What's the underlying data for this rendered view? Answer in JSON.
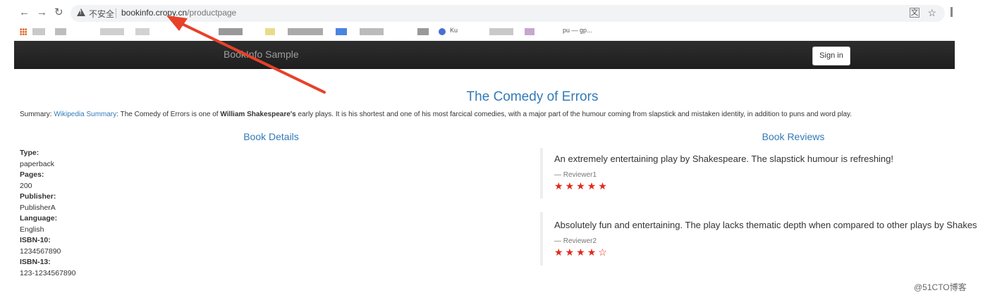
{
  "browser": {
    "insecure_label": "不安全",
    "url_domain": "bookinfo.cropy.cn",
    "url_path": "/productpage",
    "bookmark_texts": [
      "Ku",
      "pu — gp..."
    ]
  },
  "navbar": {
    "brand": "BookInfo Sample",
    "signin_label": "Sign in"
  },
  "product": {
    "title": "The Comedy of Errors",
    "summary_label": "Summary: ",
    "summary_link": "Wikipedia Summary",
    "summary_pre": ": The Comedy of Errors is one of ",
    "summary_author": "William Shakespeare's",
    "summary_post": " early plays. It is his shortest and one of his most farcical comedies, with a major part of the humour coming from slapstick and mistaken identity, in addition to puns and word play."
  },
  "details": {
    "heading": "Book Details",
    "items": [
      {
        "label": "Type:",
        "value": "paperback"
      },
      {
        "label": "Pages:",
        "value": "200"
      },
      {
        "label": "Publisher:",
        "value": "PublisherA"
      },
      {
        "label": "Language:",
        "value": "English"
      },
      {
        "label": "ISBN-10:",
        "value": "1234567890"
      },
      {
        "label": "ISBN-13:",
        "value": "123-1234567890"
      }
    ]
  },
  "reviews": {
    "heading": "Book Reviews",
    "items": [
      {
        "text": "An extremely entertaining play by Shakespeare. The slapstick humour is refreshing!",
        "reviewer": "— Reviewer1",
        "rating": 5,
        "star_color": "#e02a1c"
      },
      {
        "text": "Absolutely fun and entertaining. The play lacks thematic depth when compared to other plays by Shakespeare.",
        "reviewer": "— Reviewer2",
        "rating": 4,
        "star_color": "#e02a1c"
      }
    ]
  },
  "watermark": "@51CTO博客",
  "colors": {
    "link": "#337ab7",
    "annotation_arrow": "#e8412a"
  }
}
